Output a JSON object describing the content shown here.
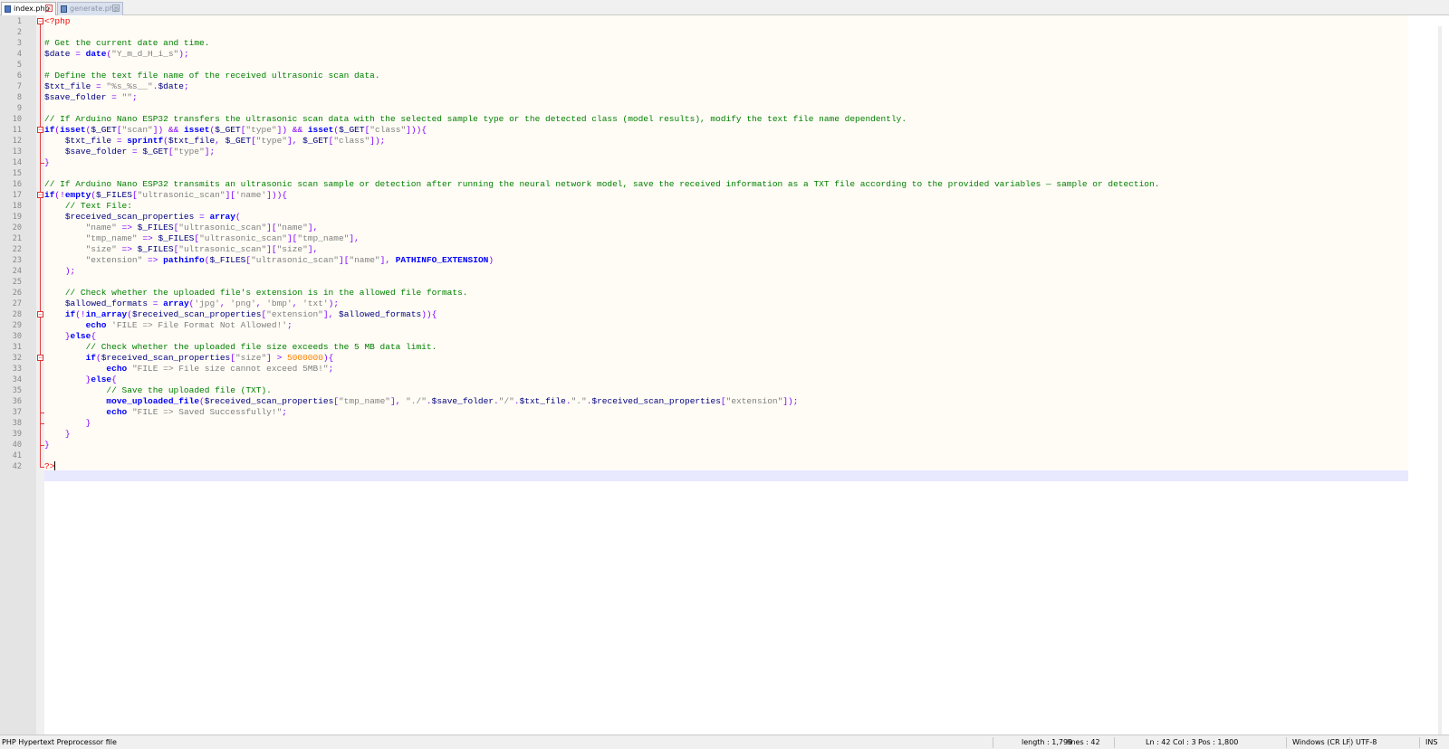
{
  "tabs": [
    {
      "label": "index.php",
      "active": true
    },
    {
      "label": "generate.php",
      "active": false
    }
  ],
  "code_lines": [
    [
      {
        "t": "<?php",
        "c": "tag"
      }
    ],
    [],
    [
      {
        "t": "# Get the current date and time.",
        "c": "cmt"
      }
    ],
    [
      {
        "t": "$date",
        "c": "var"
      },
      {
        "t": " = ",
        "c": "op"
      },
      {
        "t": "date",
        "c": "kw"
      },
      {
        "t": "(",
        "c": "op"
      },
      {
        "t": "\"Y_m_d_H_i_s\"",
        "c": "str"
      },
      {
        "t": ");",
        "c": "op"
      }
    ],
    [],
    [
      {
        "t": "# Define the text file name of the received ultrasonic scan data.",
        "c": "cmt"
      }
    ],
    [
      {
        "t": "$txt_file",
        "c": "var"
      },
      {
        "t": " = ",
        "c": "op"
      },
      {
        "t": "\"%s_%s__\"",
        "c": "str"
      },
      {
        "t": ".",
        "c": "op"
      },
      {
        "t": "$date",
        "c": "var"
      },
      {
        "t": ";",
        "c": "op"
      }
    ],
    [
      {
        "t": "$save_folder",
        "c": "var"
      },
      {
        "t": " = ",
        "c": "op"
      },
      {
        "t": "\"\"",
        "c": "str"
      },
      {
        "t": ";",
        "c": "op"
      }
    ],
    [],
    [
      {
        "t": "// If Arduino Nano ESP32 transfers the ultrasonic scan data with the selected sample type or the detected class (model results), modify the text file name dependently.",
        "c": "cmt"
      }
    ],
    [
      {
        "t": "if",
        "c": "kw"
      },
      {
        "t": "(",
        "c": "op"
      },
      {
        "t": "isset",
        "c": "kw"
      },
      {
        "t": "(",
        "c": "op"
      },
      {
        "t": "$_GET",
        "c": "var"
      },
      {
        "t": "[",
        "c": "op"
      },
      {
        "t": "\"scan\"",
        "c": "str"
      },
      {
        "t": "]) && ",
        "c": "op"
      },
      {
        "t": "isset",
        "c": "kw"
      },
      {
        "t": "(",
        "c": "op"
      },
      {
        "t": "$_GET",
        "c": "var"
      },
      {
        "t": "[",
        "c": "op"
      },
      {
        "t": "\"type\"",
        "c": "str"
      },
      {
        "t": "]) && ",
        "c": "op"
      },
      {
        "t": "isset",
        "c": "kw"
      },
      {
        "t": "(",
        "c": "op"
      },
      {
        "t": "$_GET",
        "c": "var"
      },
      {
        "t": "[",
        "c": "op"
      },
      {
        "t": "\"class\"",
        "c": "str"
      },
      {
        "t": "])){",
        "c": "op"
      }
    ],
    [
      {
        "t": "    "
      },
      {
        "t": "$txt_file",
        "c": "var"
      },
      {
        "t": " = ",
        "c": "op"
      },
      {
        "t": "sprintf",
        "c": "kw"
      },
      {
        "t": "(",
        "c": "op"
      },
      {
        "t": "$txt_file",
        "c": "var"
      },
      {
        "t": ", ",
        "c": "op"
      },
      {
        "t": "$_GET",
        "c": "var"
      },
      {
        "t": "[",
        "c": "op"
      },
      {
        "t": "\"type\"",
        "c": "str"
      },
      {
        "t": "], ",
        "c": "op"
      },
      {
        "t": "$_GET",
        "c": "var"
      },
      {
        "t": "[",
        "c": "op"
      },
      {
        "t": "\"class\"",
        "c": "str"
      },
      {
        "t": "]);",
        "c": "op"
      }
    ],
    [
      {
        "t": "    "
      },
      {
        "t": "$save_folder",
        "c": "var"
      },
      {
        "t": " = ",
        "c": "op"
      },
      {
        "t": "$_GET",
        "c": "var"
      },
      {
        "t": "[",
        "c": "op"
      },
      {
        "t": "\"type\"",
        "c": "str"
      },
      {
        "t": "];",
        "c": "op"
      }
    ],
    [
      {
        "t": "}",
        "c": "op"
      }
    ],
    [],
    [
      {
        "t": "// If Arduino Nano ESP32 transmits an ultrasonic scan sample or detection after running the neural network model, save the received information as a TXT file according to the provided variables — sample or detection.",
        "c": "cmt"
      }
    ],
    [
      {
        "t": "if",
        "c": "kw"
      },
      {
        "t": "(!",
        "c": "op"
      },
      {
        "t": "empty",
        "c": "kw"
      },
      {
        "t": "(",
        "c": "op"
      },
      {
        "t": "$_FILES",
        "c": "var"
      },
      {
        "t": "[",
        "c": "op"
      },
      {
        "t": "\"ultrasonic_scan\"",
        "c": "str"
      },
      {
        "t": "][",
        "c": "op"
      },
      {
        "t": "'name'",
        "c": "str"
      },
      {
        "t": "])){",
        "c": "op"
      }
    ],
    [
      {
        "t": "    "
      },
      {
        "t": "// Text File:",
        "c": "cmt"
      }
    ],
    [
      {
        "t": "    "
      },
      {
        "t": "$received_scan_properties",
        "c": "var"
      },
      {
        "t": " = ",
        "c": "op"
      },
      {
        "t": "array",
        "c": "kw"
      },
      {
        "t": "(",
        "c": "op"
      }
    ],
    [
      {
        "t": "        "
      },
      {
        "t": "\"name\"",
        "c": "str"
      },
      {
        "t": " => ",
        "c": "op"
      },
      {
        "t": "$_FILES",
        "c": "var"
      },
      {
        "t": "[",
        "c": "op"
      },
      {
        "t": "\"ultrasonic_scan\"",
        "c": "str"
      },
      {
        "t": "][",
        "c": "op"
      },
      {
        "t": "\"name\"",
        "c": "str"
      },
      {
        "t": "],",
        "c": "op"
      }
    ],
    [
      {
        "t": "        "
      },
      {
        "t": "\"tmp_name\"",
        "c": "str"
      },
      {
        "t": " => ",
        "c": "op"
      },
      {
        "t": "$_FILES",
        "c": "var"
      },
      {
        "t": "[",
        "c": "op"
      },
      {
        "t": "\"ultrasonic_scan\"",
        "c": "str"
      },
      {
        "t": "][",
        "c": "op"
      },
      {
        "t": "\"tmp_name\"",
        "c": "str"
      },
      {
        "t": "],",
        "c": "op"
      }
    ],
    [
      {
        "t": "        "
      },
      {
        "t": "\"size\"",
        "c": "str"
      },
      {
        "t": " => ",
        "c": "op"
      },
      {
        "t": "$_FILES",
        "c": "var"
      },
      {
        "t": "[",
        "c": "op"
      },
      {
        "t": "\"ultrasonic_scan\"",
        "c": "str"
      },
      {
        "t": "][",
        "c": "op"
      },
      {
        "t": "\"size\"",
        "c": "str"
      },
      {
        "t": "],",
        "c": "op"
      }
    ],
    [
      {
        "t": "        "
      },
      {
        "t": "\"extension\"",
        "c": "str"
      },
      {
        "t": " => ",
        "c": "op"
      },
      {
        "t": "pathinfo",
        "c": "kw"
      },
      {
        "t": "(",
        "c": "op"
      },
      {
        "t": "$_FILES",
        "c": "var"
      },
      {
        "t": "[",
        "c": "op"
      },
      {
        "t": "\"ultrasonic_scan\"",
        "c": "str"
      },
      {
        "t": "][",
        "c": "op"
      },
      {
        "t": "\"name\"",
        "c": "str"
      },
      {
        "t": "], ",
        "c": "op"
      },
      {
        "t": "PATHINFO_EXTENSION",
        "c": "const"
      },
      {
        "t": ")",
        "c": "op"
      }
    ],
    [
      {
        "t": "    "
      },
      {
        "t": ");",
        "c": "op"
      }
    ],
    [],
    [
      {
        "t": "    "
      },
      {
        "t": "// Check whether the uploaded file's extension is in the allowed file formats.",
        "c": "cmt"
      }
    ],
    [
      {
        "t": "    "
      },
      {
        "t": "$allowed_formats",
        "c": "var"
      },
      {
        "t": " = ",
        "c": "op"
      },
      {
        "t": "array",
        "c": "kw"
      },
      {
        "t": "(",
        "c": "op"
      },
      {
        "t": "'jpg'",
        "c": "str"
      },
      {
        "t": ", ",
        "c": "op"
      },
      {
        "t": "'png'",
        "c": "str"
      },
      {
        "t": ", ",
        "c": "op"
      },
      {
        "t": "'bmp'",
        "c": "str"
      },
      {
        "t": ", ",
        "c": "op"
      },
      {
        "t": "'txt'",
        "c": "str"
      },
      {
        "t": ");",
        "c": "op"
      }
    ],
    [
      {
        "t": "    "
      },
      {
        "t": "if",
        "c": "kw"
      },
      {
        "t": "(!",
        "c": "op"
      },
      {
        "t": "in_array",
        "c": "kw"
      },
      {
        "t": "(",
        "c": "op"
      },
      {
        "t": "$received_scan_properties",
        "c": "var"
      },
      {
        "t": "[",
        "c": "op"
      },
      {
        "t": "\"extension\"",
        "c": "str"
      },
      {
        "t": "], ",
        "c": "op"
      },
      {
        "t": "$allowed_formats",
        "c": "var"
      },
      {
        "t": ")){",
        "c": "op"
      }
    ],
    [
      {
        "t": "        "
      },
      {
        "t": "echo",
        "c": "kw"
      },
      {
        "t": " "
      },
      {
        "t": "'FILE => File Format Not Allowed!'",
        "c": "str"
      },
      {
        "t": ";",
        "c": "op"
      }
    ],
    [
      {
        "t": "    "
      },
      {
        "t": "}",
        "c": "op"
      },
      {
        "t": "else",
        "c": "kw"
      },
      {
        "t": "{",
        "c": "op"
      }
    ],
    [
      {
        "t": "        "
      },
      {
        "t": "// Check whether the uploaded file size exceeds the 5 MB data limit.",
        "c": "cmt"
      }
    ],
    [
      {
        "t": "        "
      },
      {
        "t": "if",
        "c": "kw"
      },
      {
        "t": "(",
        "c": "op"
      },
      {
        "t": "$received_scan_properties",
        "c": "var"
      },
      {
        "t": "[",
        "c": "op"
      },
      {
        "t": "\"size\"",
        "c": "str"
      },
      {
        "t": "] > ",
        "c": "op"
      },
      {
        "t": "5000000",
        "c": "num"
      },
      {
        "t": "){",
        "c": "op"
      }
    ],
    [
      {
        "t": "            "
      },
      {
        "t": "echo",
        "c": "kw"
      },
      {
        "t": " "
      },
      {
        "t": "\"FILE => File size cannot exceed 5MB!\"",
        "c": "str"
      },
      {
        "t": ";",
        "c": "op"
      }
    ],
    [
      {
        "t": "        "
      },
      {
        "t": "}",
        "c": "op"
      },
      {
        "t": "else",
        "c": "kw"
      },
      {
        "t": "{",
        "c": "op"
      }
    ],
    [
      {
        "t": "            "
      },
      {
        "t": "// Save the uploaded file (TXT).",
        "c": "cmt"
      }
    ],
    [
      {
        "t": "            "
      },
      {
        "t": "move_uploaded_file",
        "c": "kw"
      },
      {
        "t": "(",
        "c": "op"
      },
      {
        "t": "$received_scan_properties",
        "c": "var"
      },
      {
        "t": "[",
        "c": "op"
      },
      {
        "t": "\"tmp_name\"",
        "c": "str"
      },
      {
        "t": "], ",
        "c": "op"
      },
      {
        "t": "\"./\"",
        "c": "str"
      },
      {
        "t": ".",
        "c": "op"
      },
      {
        "t": "$save_folder",
        "c": "var"
      },
      {
        "t": ".",
        "c": "op"
      },
      {
        "t": "\"/\"",
        "c": "str"
      },
      {
        "t": ".",
        "c": "op"
      },
      {
        "t": "$txt_file",
        "c": "var"
      },
      {
        "t": ".",
        "c": "op"
      },
      {
        "t": "\".\"",
        "c": "str"
      },
      {
        "t": ".",
        "c": "op"
      },
      {
        "t": "$received_scan_properties",
        "c": "var"
      },
      {
        "t": "[",
        "c": "op"
      },
      {
        "t": "\"extension\"",
        "c": "str"
      },
      {
        "t": "]);",
        "c": "op"
      }
    ],
    [
      {
        "t": "            "
      },
      {
        "t": "echo",
        "c": "kw"
      },
      {
        "t": " "
      },
      {
        "t": "\"FILE => Saved Successfully!\"",
        "c": "str"
      },
      {
        "t": ";",
        "c": "op"
      }
    ],
    [
      {
        "t": "        "
      },
      {
        "t": "}",
        "c": "op"
      }
    ],
    [
      {
        "t": "    "
      },
      {
        "t": "}",
        "c": "op"
      }
    ],
    [
      {
        "t": "}",
        "c": "op"
      }
    ],
    [],
    [
      {
        "t": "?>",
        "c": "tag"
      }
    ]
  ],
  "status": {
    "file_type": "PHP Hypertext Preprocessor file",
    "length": "length : 1,799",
    "lines": "lines : 42",
    "ln": "Ln : 42",
    "col": "Col : 3",
    "pos": "Pos : 1,800",
    "eol": "Windows (CR LF)",
    "encoding": "UTF-8",
    "mode": "INS"
  },
  "colors": {
    "comment": "#008000",
    "keyword": "#0000ff",
    "variable": "#000080",
    "string": "#808080",
    "operator": "#8000ff",
    "number": "#ff8000",
    "php_tag": "#ff0000",
    "current_line": "#e8e8ff"
  }
}
